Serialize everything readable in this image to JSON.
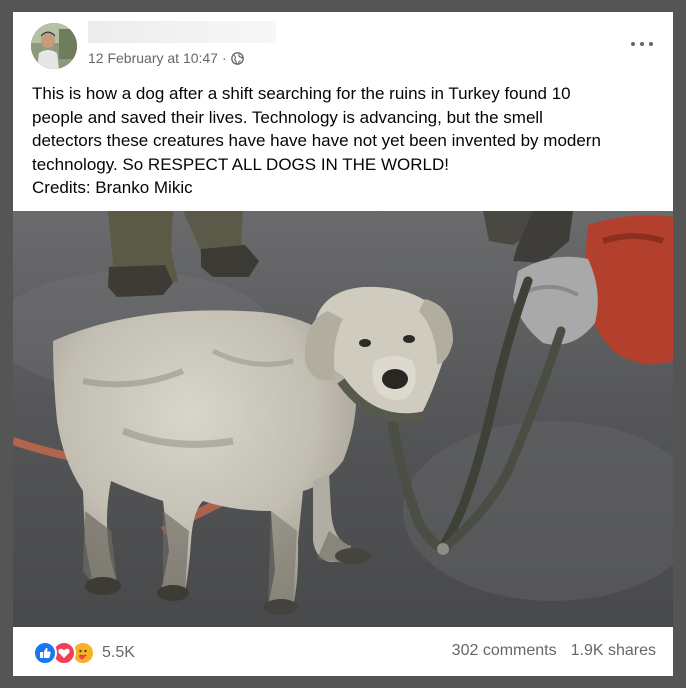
{
  "post": {
    "timestamp": "12 February at 10:47",
    "separator": "·",
    "privacy_icon": "globe-icon",
    "text_lines": [
      "This is how a dog after a shift searching for the ruins in Turkey found 10",
      "people and saved their lives. Technology is advancing, but the smell",
      "detectors these creatures have have have not yet been invented by modern",
      "technology. So RESPECT ALL DOGS IN THE WORLD!",
      "Credits: Branko Mikic"
    ]
  },
  "footer": {
    "reaction_icons": [
      "like-icon",
      "love-icon",
      "care-icon"
    ],
    "reaction_count": "5.5K",
    "comments": "302 comments",
    "shares": "1.9K shares"
  },
  "colors": {
    "text": "#050505",
    "meta": "#65676b",
    "like": "#1877f2",
    "love": "#f33e58",
    "care": "#f7b125"
  }
}
